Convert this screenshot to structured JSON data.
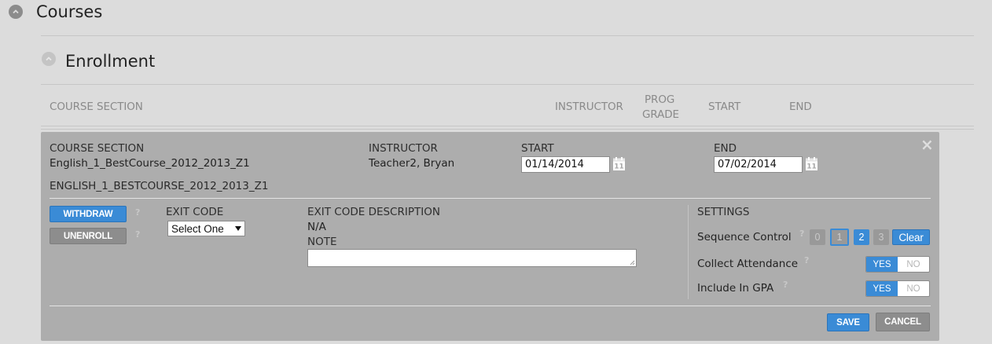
{
  "courses": {
    "title": "Courses"
  },
  "enrollment": {
    "title": "Enrollment"
  },
  "table_headers": {
    "course_section": "COURSE SECTION",
    "instructor": "INSTRUCTOR",
    "prog": "PROG",
    "grade": "GRADE",
    "start": "START",
    "end": "END"
  },
  "panel": {
    "course_section_label": "COURSE SECTION",
    "course_section_value": "English_1_BestCourse_2012_2013_Z1",
    "course_section_code": "ENGLISH_1_BESTCOURSE_2012_2013_Z1",
    "instructor_label": "INSTRUCTOR",
    "instructor_value": "Teacher2, Bryan",
    "start_label": "START",
    "start_value": "01/14/2014",
    "end_label": "END",
    "end_value": "07/02/2014",
    "close_glyph": "×",
    "withdraw_label": "WITHDRAW",
    "unenroll_label": "UNENROLL",
    "help_glyph": "?",
    "exit_code_label": "EXIT CODE",
    "exit_code_selected": "Select One",
    "exit_desc_label": "EXIT CODE DESCRIPTION",
    "exit_desc_value": "N/A",
    "note_label": "NOTE",
    "settings_label": "SETTINGS",
    "sequence_label": "Sequence Control",
    "sequence_values": [
      "0",
      "1",
      "2",
      "3"
    ],
    "clear_label": "Clear",
    "attendance_label": "Collect Attendance",
    "gpa_label": "Include In GPA",
    "yes_label": "YES",
    "no_label": "NO",
    "save_label": "SAVE",
    "cancel_label": "CANCEL",
    "calendar_day": "11"
  },
  "colors": {
    "accent": "#3a8bd6",
    "panel": "#adadad",
    "background": "#dcdcdc"
  }
}
